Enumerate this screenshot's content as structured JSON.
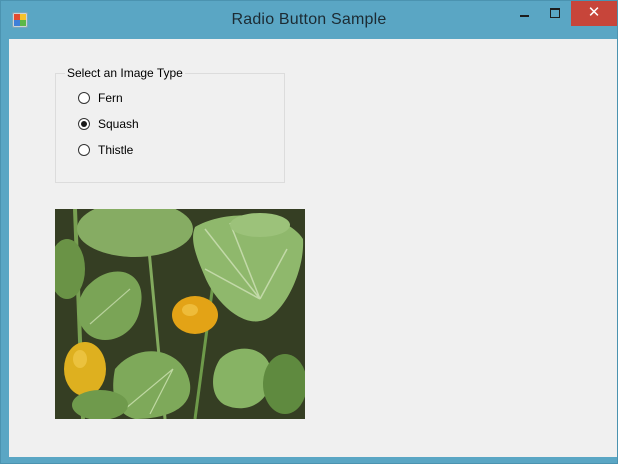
{
  "window": {
    "title": "Radio Button Sample",
    "controls": {
      "minimize_icon": "minimize-icon",
      "maximize_icon": "maximize-icon",
      "close_glyph": "✕"
    }
  },
  "groupbox": {
    "label": "Select an Image Type",
    "options": [
      {
        "label": "Fern",
        "checked": false
      },
      {
        "label": "Squash",
        "checked": true
      },
      {
        "label": "Thistle",
        "checked": false
      }
    ]
  },
  "picture": {
    "subject": "squash-plant-photo",
    "colors": {
      "leaf": "#6f9a4c",
      "squash": "#e3a316",
      "soil": "#2f3020"
    }
  },
  "colors": {
    "titlebar": "#5aa6c4",
    "client": "#f0f0f0",
    "close": "#c7453a"
  }
}
